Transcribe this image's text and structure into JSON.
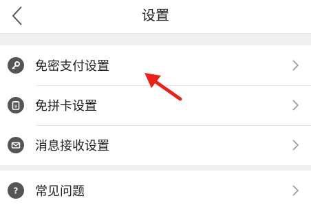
{
  "header": {
    "title": "设置",
    "back_icon": "chevron-left-icon"
  },
  "groups": [
    {
      "items": [
        {
          "label": "免密支付设置",
          "icon": "key-icon"
        },
        {
          "label": "免拼卡设置",
          "icon": "card-icon"
        },
        {
          "label": "消息接收设置",
          "icon": "mail-icon"
        }
      ]
    },
    {
      "items": [
        {
          "label": "常见问题",
          "icon": "question-icon"
        }
      ]
    }
  ],
  "annotation": {
    "icon": "red-arrow-icon",
    "color": "#e8231c"
  },
  "colors": {
    "background": "#f0f0f0",
    "row_background": "#ffffff",
    "icon_color": "#555555",
    "chevron_color": "#999999",
    "text": "#222222"
  }
}
